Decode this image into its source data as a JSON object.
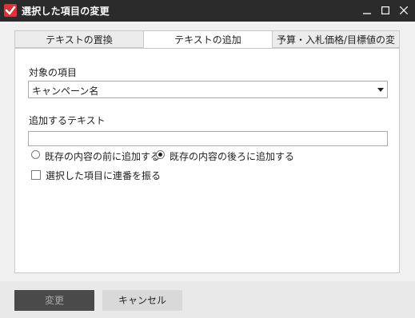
{
  "window": {
    "title": "選択した項目の変更"
  },
  "tabs": [
    {
      "label": "テキストの置換"
    },
    {
      "label": "テキストの追加"
    },
    {
      "label": "予算・入札価格/目標値の変更"
    }
  ],
  "form": {
    "target_label": "対象の項目",
    "target_value": "キャンペーン名",
    "add_text_label": "追加するテキスト",
    "add_text_value": "",
    "radio_before": "既存の内容の前に追加する",
    "radio_after": "既存の内容の後ろに追加する",
    "selected_radio": "after",
    "checkbox_label": "選択した項目に連番を振る",
    "checkbox_checked": false
  },
  "buttons": {
    "change": "変更",
    "cancel": "キャンセル"
  },
  "colors": {
    "titlebar": "#2b2b2b",
    "app_icon": "#d8343a",
    "primary_button_disabled": "#4a4a4a"
  }
}
